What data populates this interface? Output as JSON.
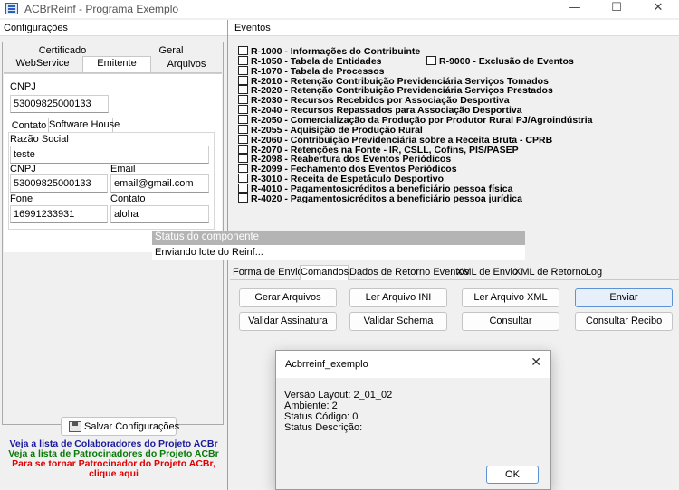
{
  "window": {
    "title": "ACBrReinf - Programa Exemplo",
    "minimize": "—",
    "maximize": "☐",
    "close": "✕"
  },
  "left": {
    "header": "Configurações",
    "tabs_row1": [
      "Certificado",
      "Geral"
    ],
    "tabs_row2": [
      "WebService",
      "Emitente",
      "Arquivos"
    ],
    "cnpj_label": "CNPJ",
    "cnpj_value": "53009825000133",
    "subtabs": [
      "Contato",
      "Software House"
    ],
    "razao_label": "Razão Social",
    "razao_value": "teste",
    "sw_cnpj_label": "CNPJ",
    "sw_cnpj_value": "53009825000133",
    "email_label": "Email",
    "email_value": "email@gmail.com",
    "fone_label": "Fone",
    "fone_value": "16991233931",
    "contato_label": "Contato",
    "contato_value": "aloha",
    "save_button": "Salvar Configurações",
    "links": [
      {
        "text": "Veja a lista de Colaboradores do Projeto ACBr",
        "color": "#1a1a9c"
      },
      {
        "text": "Veja a lista de Patrocinadores do Projeto ACBr",
        "color": "#0a7a0a"
      },
      {
        "text": "Para se tornar Patrocinador do Projeto ACBr,",
        "color": "#e00000"
      },
      {
        "text": "clique aqui",
        "color": "#e00000"
      }
    ]
  },
  "right": {
    "header": "Eventos",
    "events": [
      "R-1000 - Informações do Contribuinte",
      "R-1050 - Tabela de Entidades",
      "R-1070 - Tabela de Processos",
      "R-2010 - Retenção Contribuição Previdenciária  Serviços Tomados",
      "R-2020 - Retenção Contribuição Previdenciária  Serviços Prestados",
      "R-2030 - Recursos Recebidos por Associação Desportiva",
      "R-2040 - Recursos Repassados para Associação Desportiva",
      "R-2050 - Comercialização da Produção por Produtor Rural PJ/Agroindústria",
      "R-2055 - Aquisição de Produção Rural",
      "R-2060 - Contribuição Previdenciária sobre a Receita Bruta - CPRB",
      "R-2070 - Retenções na Fonte - IR, CSLL, Cofins, PIS/PASEP",
      "R-2098 - Reabertura dos Eventos Periódicos",
      "R-2099 - Fechamento dos Eventos Periódicos",
      "R-3010 - Receita de Espetáculo Desportivo",
      "R-4010 - Pagamentos/créditos a beneficiário pessoa física",
      "R-4020 - Pagamentos/créditos a beneficiário pessoa jurídica"
    ],
    "event_9000": "R-9000 - Exclusão de Eventos",
    "tabs": [
      "Forma de Envio",
      "Comandos",
      "Dados de Retorno Eventos",
      "XML de Envio",
      "XML de Retorno",
      "Log"
    ],
    "buttons_row1": [
      "Gerar Arquivos",
      "Ler Arquivo INI",
      "Ler Arquivo XML",
      "Enviar"
    ],
    "buttons_row2": [
      "Validar Assinatura",
      "Validar Schema",
      "Consultar",
      "Consultar Recibo"
    ]
  },
  "status": {
    "title": "Status do componente",
    "message": "Enviando lote do Reinf..."
  },
  "dialog": {
    "title": "Acbrreinf_exemplo",
    "lines": [
      "Versão Layout: 2_01_02",
      "Ambiente: 2",
      "Status Código: 0",
      "Status Descrição:"
    ],
    "ok": "OK"
  }
}
